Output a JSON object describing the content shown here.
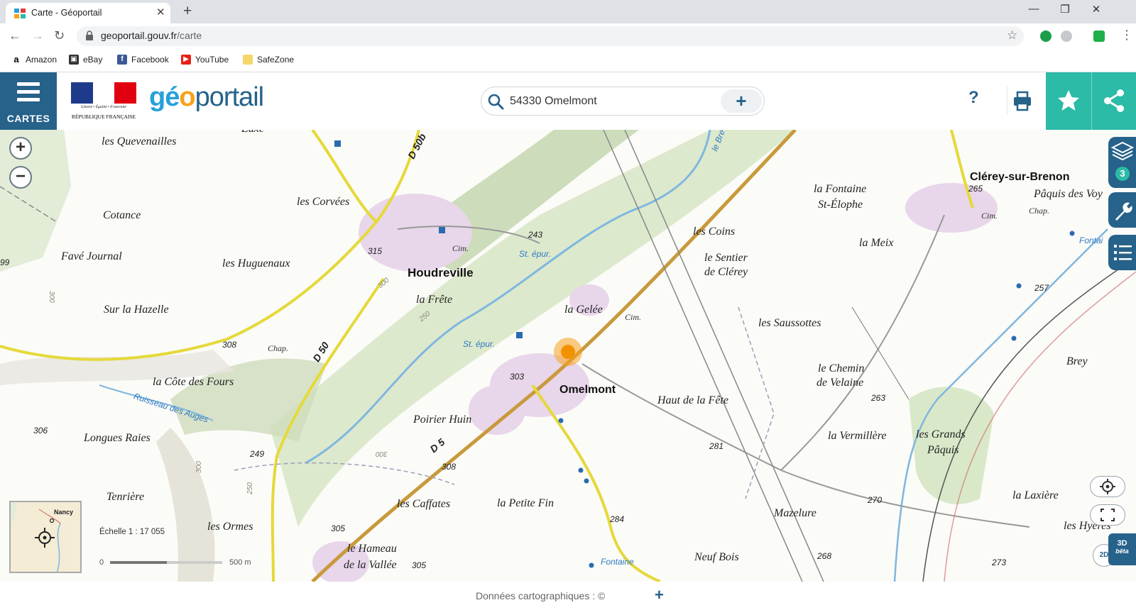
{
  "browser": {
    "tab_title": "Carte - Géoportail",
    "url_domain": "geoportail.gouv.fr",
    "url_path": "/carte",
    "bookmarks": [
      {
        "label": "Amazon",
        "icon": "amazon-icon"
      },
      {
        "label": "eBay",
        "icon": "ebay-icon"
      },
      {
        "label": "Facebook",
        "icon": "facebook-icon"
      },
      {
        "label": "YouTube",
        "icon": "youtube-icon"
      },
      {
        "label": "SafeZone",
        "icon": "folder-icon"
      }
    ]
  },
  "header": {
    "menu_label": "CARTES",
    "rf_motto": "Liberté • Égalité • Fraternité",
    "rf_name": "RÉPUBLIQUE FRANÇAISE",
    "logo_parts": [
      "gé",
      "o",
      "portail"
    ],
    "search_value": "54330 Omelmont",
    "help_label": "?",
    "colors": {
      "brand_blue": "#26628a",
      "teal": "#2bbba7",
      "orange": "#f7a21b"
    }
  },
  "map": {
    "places": [
      "Euxe",
      "les Quevenailles",
      "les Corvées",
      "Cotance",
      "Favé Journal",
      "les Huguenaux",
      "Sur la Hazelle",
      "la Frête",
      "la Gelée",
      "les Coins",
      "le Sentier",
      "de Clérey",
      "les Saussottes",
      "la Fontaine",
      "St-Élophe",
      "la Meix",
      "Pâquis des Voy",
      "le Chemin",
      "de Velaine",
      "Haut de la Fête",
      "Brey",
      "la Côte des Fours",
      "Longues Raies",
      "Tenrière",
      "les Ormes",
      "Poirier Huin",
      "les Caffates",
      "la Petite Fin",
      "la Vermillère",
      "les Grands",
      "Pâquis",
      "Mazelure",
      "la Laxière",
      "les Hyeres",
      "Neuf Bois",
      "le Hameau",
      "de la Vallée"
    ],
    "towns": [
      "Houdreville",
      "Omelmont",
      "Clérey-sur-Brenon"
    ],
    "roads": [
      "D 50b",
      "D 50",
      "D 5"
    ],
    "small_labels": [
      "Cim.",
      "Cim.",
      "Cim.",
      "Chap.",
      "Chap.",
      "St. épur.",
      "St. épur."
    ],
    "water_labels": [
      "Ruisseau des Auges",
      "Fontaine",
      "Fontai",
      "le Bre"
    ],
    "altitudes": [
      "315",
      "243",
      "308",
      "303",
      "308",
      "306",
      "249",
      "305",
      "305",
      "284",
      "281",
      "263",
      "270",
      "268",
      "273",
      "257",
      "265",
      "300",
      "250",
      "300",
      "99",
      "300",
      "250",
      "300"
    ],
    "layers_count": "3",
    "mode_2d": "2D",
    "mode_3d": "3D",
    "mode_3d_sub": "bêta",
    "overview_label": "Nancy",
    "scale_title": "Échelle 1 : 17 055",
    "scale_start": "0",
    "scale_end": "500 m"
  },
  "footer": {
    "credits": "Données cartographiques : ©",
    "credits_plus": "+"
  }
}
